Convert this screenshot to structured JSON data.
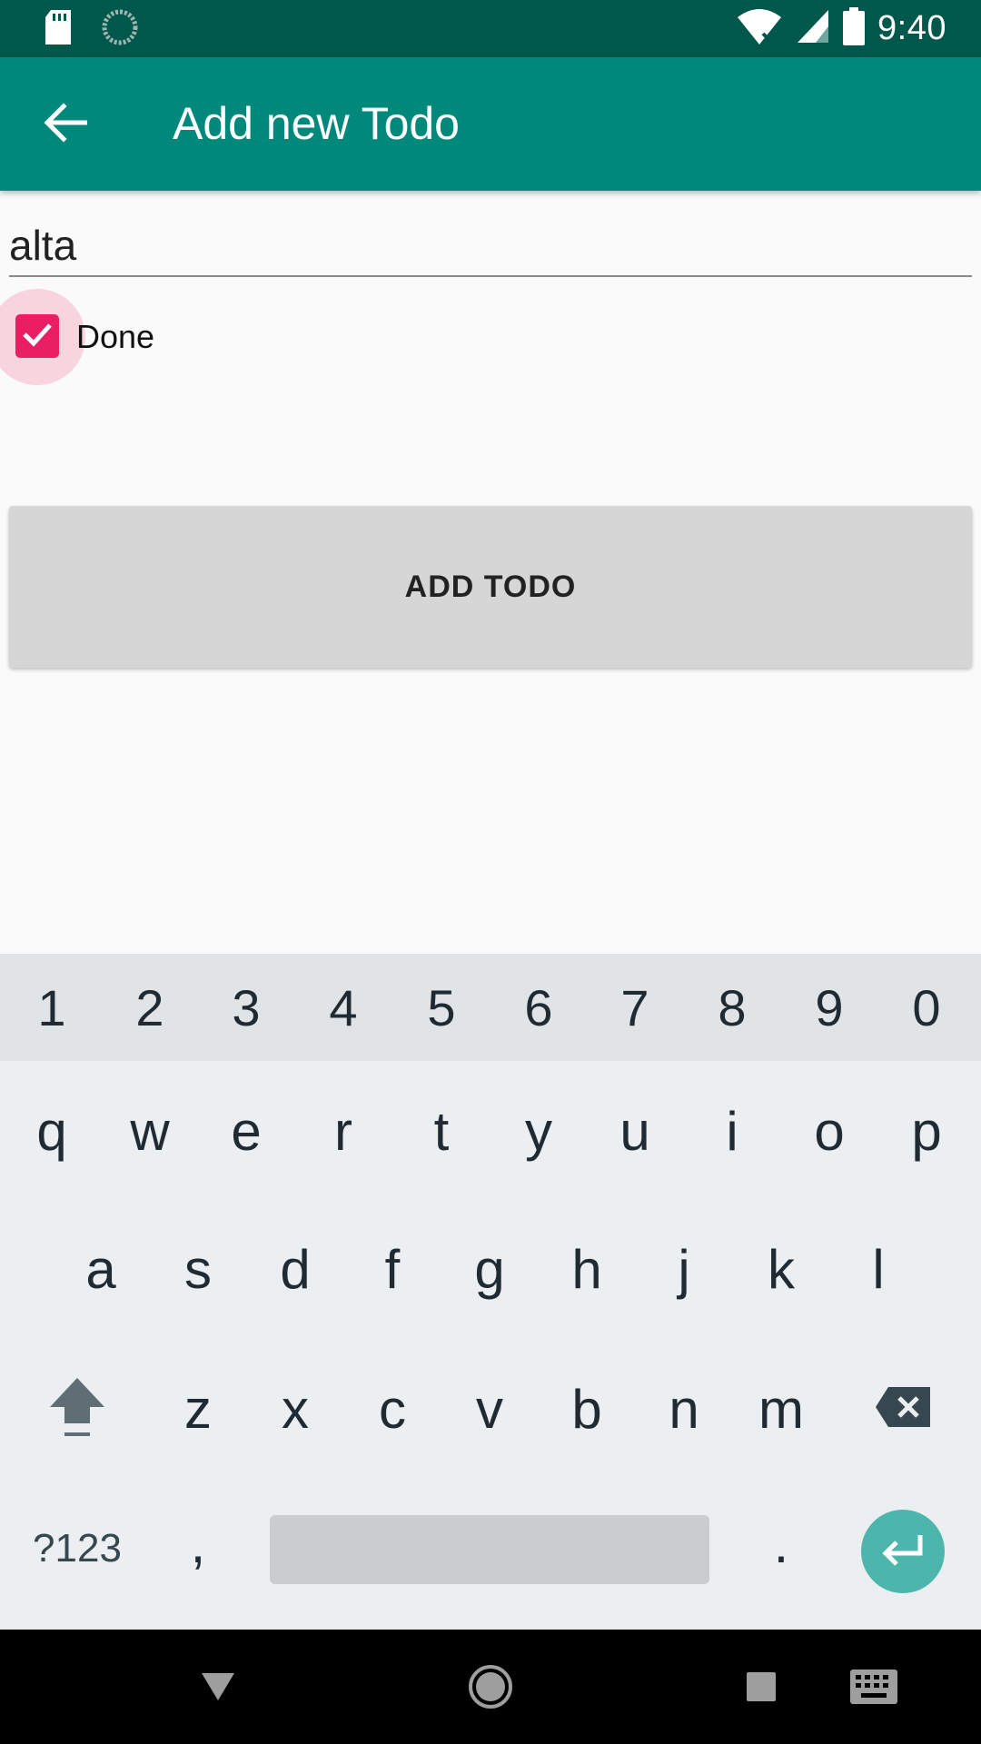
{
  "status_bar": {
    "time": "9:40",
    "icons": [
      "sd-card-icon",
      "sync-icon",
      "wifi-off-icon",
      "signal-icon",
      "battery-icon"
    ]
  },
  "app_bar": {
    "title": "Add new Todo",
    "back_icon": "arrow-back-icon",
    "color": "#00897b"
  },
  "form": {
    "todo_text": "alta",
    "done_label": "Done",
    "done_checked": true,
    "add_button_label": "ADD TODO",
    "accent_color": "#e91e63"
  },
  "keyboard": {
    "number_row": [
      "1",
      "2",
      "3",
      "4",
      "5",
      "6",
      "7",
      "8",
      "9",
      "0"
    ],
    "row1": [
      "q",
      "w",
      "e",
      "r",
      "t",
      "y",
      "u",
      "i",
      "o",
      "p"
    ],
    "row2": [
      "a",
      "s",
      "d",
      "f",
      "g",
      "h",
      "j",
      "k",
      "l"
    ],
    "row3": [
      "z",
      "x",
      "c",
      "v",
      "b",
      "n",
      "m"
    ],
    "symbols_label": "?123",
    "comma": ",",
    "period": ".",
    "shift_icon": "shift-icon",
    "backspace_icon": "backspace-icon",
    "enter_icon": "enter-icon",
    "enter_color": "#4db6ac"
  },
  "nav_bar": {
    "buttons": [
      "back-triangle-icon",
      "home-circle-icon",
      "recents-square-icon",
      "keyboard-switch-icon"
    ]
  }
}
